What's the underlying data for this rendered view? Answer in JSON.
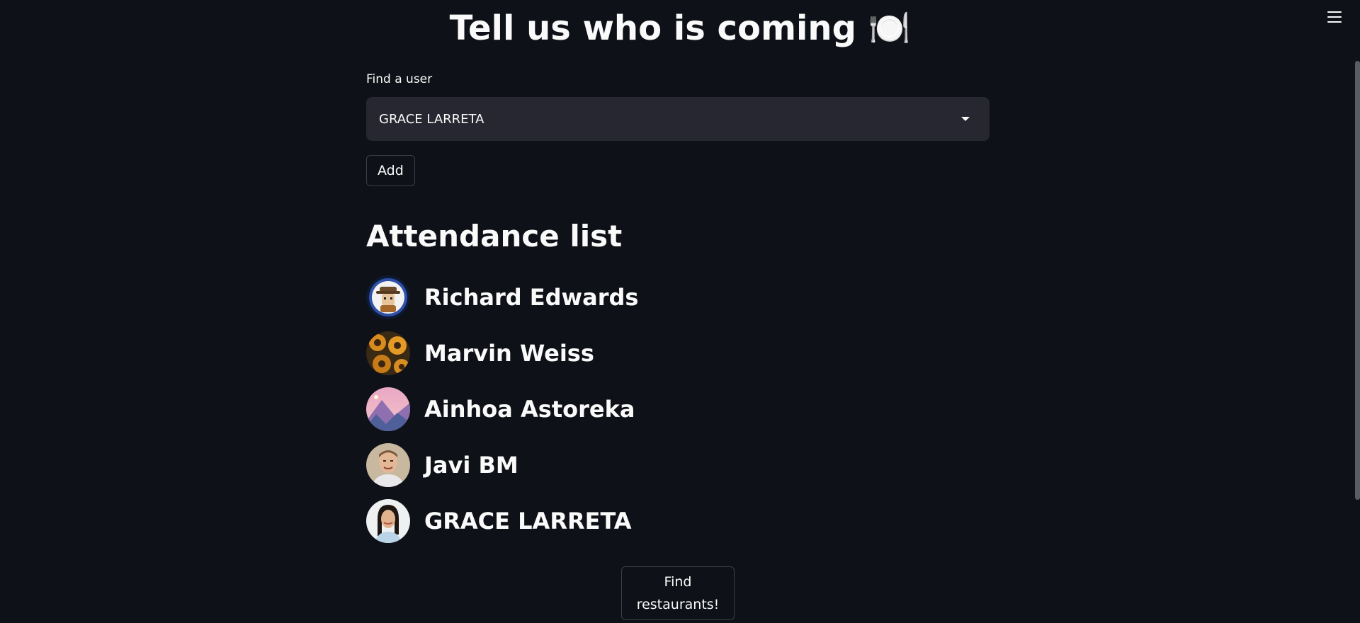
{
  "header": {
    "title": "Tell us who is coming 🍽️"
  },
  "user_picker": {
    "label": "Find a user",
    "selected_value": "GRACE LARRETA",
    "add_label": "Add"
  },
  "attendance": {
    "heading": "Attendance list",
    "attendees": [
      {
        "name": "Richard Edwards",
        "avatar": "cartoon-man-hat-avatar"
      },
      {
        "name": "Marvin Weiss",
        "avatar": "sunflowers-avatar"
      },
      {
        "name": "Ainhoa Astoreka",
        "avatar": "mountain-sunset-avatar"
      },
      {
        "name": "Javi BM",
        "avatar": "man-photo-avatar"
      },
      {
        "name": "GRACE LARRETA",
        "avatar": "woman-photo-avatar"
      }
    ]
  },
  "actions": {
    "find_restaurants_label": "Find restaurants!"
  },
  "colors": {
    "background": "#0e1117",
    "input_background": "#262730",
    "text": "#fafafa"
  }
}
